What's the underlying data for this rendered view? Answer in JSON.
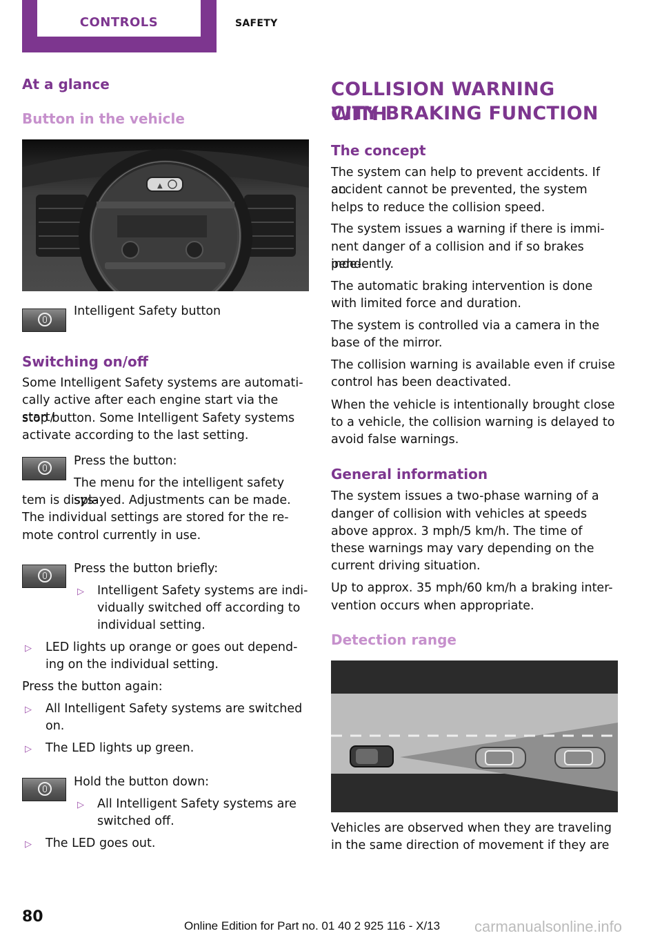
{
  "header": {
    "tab_active": "CONTROLS",
    "tab_section": "SAFETY"
  },
  "left": {
    "at_a_glance": "At a glance",
    "button_in_vehicle": "Button in the vehicle",
    "dashboard_image_alt": "Center console with Intelligent Safety button",
    "button_caption": "Intelligent Safety button",
    "switching_heading": "Switching on/off",
    "switching_lines": [
      "Some Intelligent Safety systems are automati-",
      "cally active after each engine start via the start/",
      "stop button. Some Intelligent Safety systems",
      "activate according to the last setting."
    ],
    "press_button": "Press the button:",
    "press_button_desc": [
      "The menu for the intelligent safety sys-",
      "tem is displayed. Adjustments can be made.",
      "The individual settings are stored for the re-",
      "mote control currently in use."
    ],
    "press_briefly": "Press the button briefly:",
    "briefly_bullet_lines": [
      "Intelligent Safety systems are indi-",
      "vidually switched off according to",
      "individual setting."
    ],
    "led_orange_lines": [
      "LED lights up orange or goes out depend-",
      "ing on the individual setting."
    ],
    "press_again": "Press the button again:",
    "all_on_lines": [
      "All Intelligent Safety systems are switched",
      "on."
    ],
    "led_green": "The LED lights up green.",
    "hold_down": "Hold the button down:",
    "all_off_lines": [
      "All Intelligent Safety systems are",
      "switched off."
    ],
    "led_out": "The LED goes out."
  },
  "right": {
    "title_lines": [
      "COLLISION WARNING WITH",
      "CITY BRAKING FUNCTION"
    ],
    "concept_heading": "The concept",
    "concept_paragraphs": [
      [
        "The system can help to prevent accidents. If an",
        "accident cannot be prevented, the system",
        "helps to reduce the collision speed."
      ],
      [
        "The system issues a warning if there is immi-",
        "nent danger of a collision and if so brakes inde-",
        "pendently."
      ],
      [
        "The automatic braking intervention is done",
        "with limited force and duration."
      ],
      [
        "The system is controlled via a camera in the",
        "base of the mirror."
      ],
      [
        "The collision warning is available even if cruise",
        "control has been deactivated."
      ],
      [
        "When the vehicle is intentionally brought close",
        "to a vehicle, the collision warning is delayed to",
        "avoid false warnings."
      ]
    ],
    "general_heading": "General information",
    "general_paragraphs": [
      [
        "The system issues a two-phase warning of a",
        "danger of collision with vehicles at speeds",
        "above approx. 3 mph/5 km/h. The time of",
        "these warnings may vary depending on the",
        "current driving situation."
      ],
      [
        "Up to approx. 35 mph/60 km/h a braking inter-",
        "vention occurs when appropriate."
      ]
    ],
    "detection_heading": "Detection range",
    "detection_image_alt": "Detection range of the camera ahead of the vehicle",
    "detection_lines": [
      "Vehicles are observed when they are traveling",
      "in the same direction of movement if they are"
    ]
  },
  "footer": {
    "page_number": "80",
    "edition": "Online Edition for Part no. 01 40 2 925 116 - X/13",
    "watermark": "carmanualsonline.info"
  },
  "colors": {
    "brand_purple": "#7d368f",
    "light_purple": "#c690cc"
  }
}
